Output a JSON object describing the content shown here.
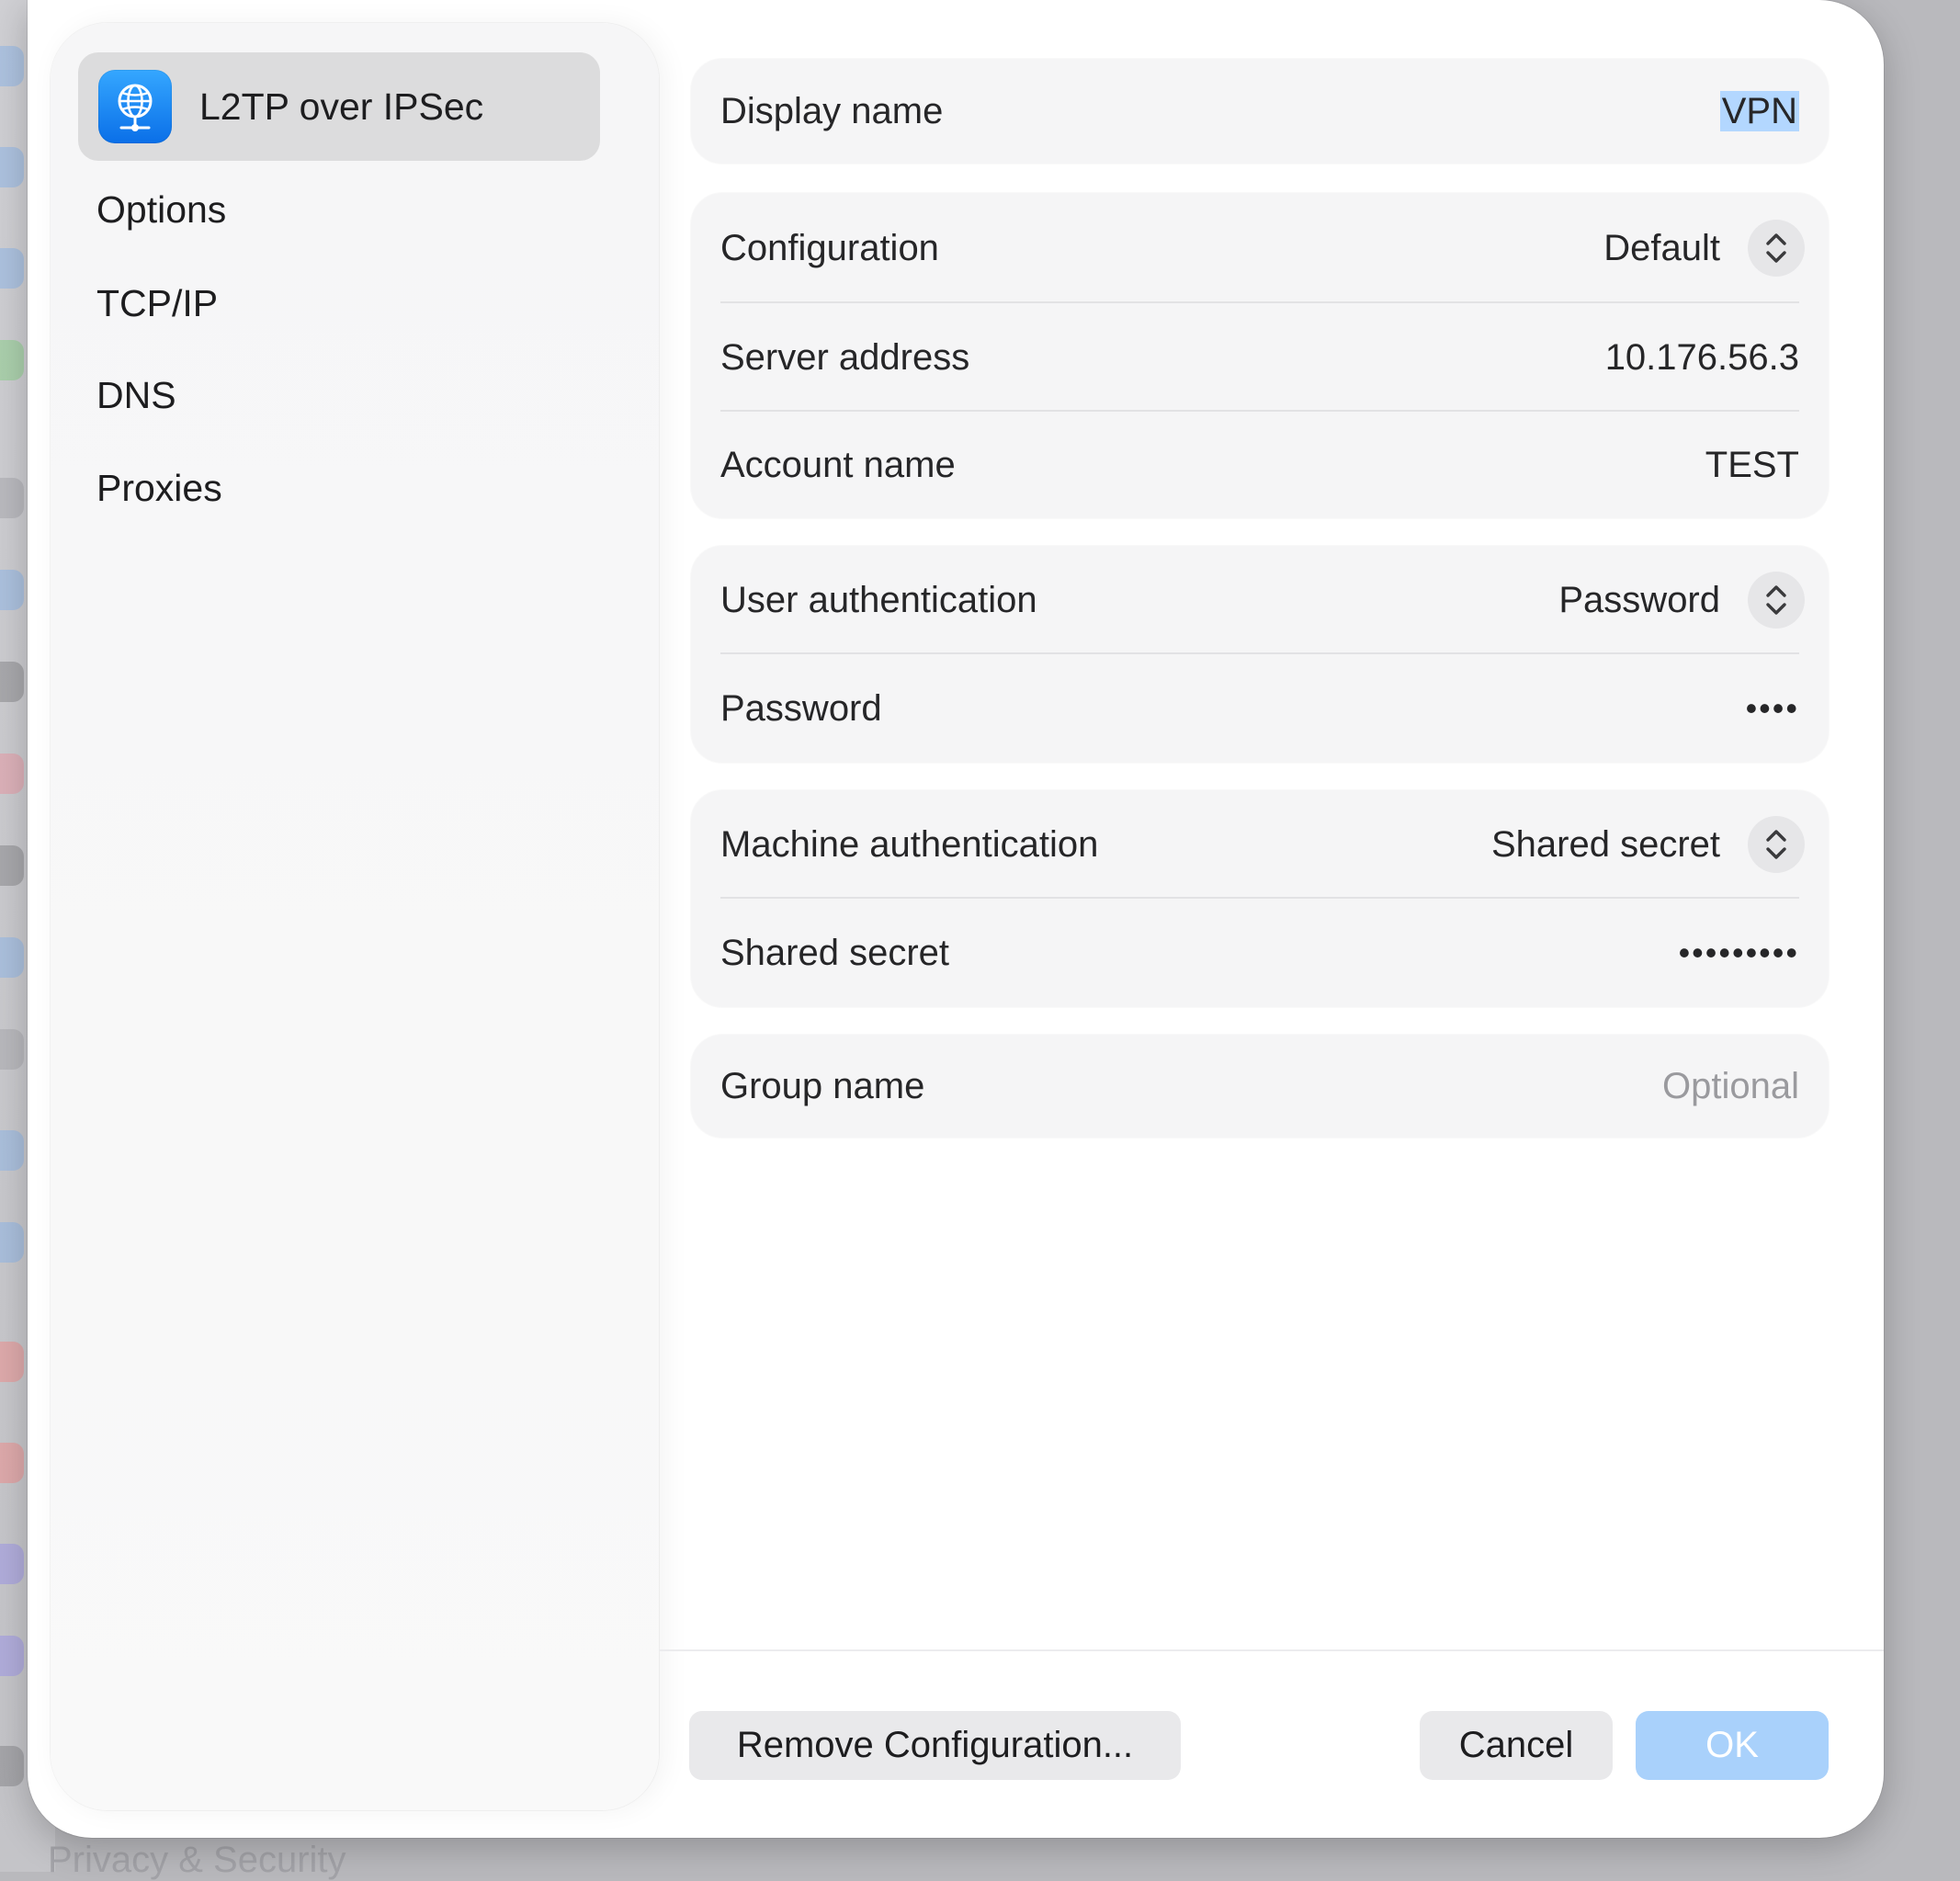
{
  "background": {
    "bottom_label": "Privacy & Security"
  },
  "sidebar": {
    "selected": {
      "label": "L2TP over IPSec",
      "icon": "globe-network-icon"
    },
    "items": [
      {
        "label": "Options"
      },
      {
        "label": "TCP/IP"
      },
      {
        "label": "DNS"
      },
      {
        "label": "Proxies"
      }
    ]
  },
  "display_name": {
    "label": "Display name",
    "value": "VPN"
  },
  "connection": {
    "configuration": {
      "label": "Configuration",
      "value": "Default"
    },
    "server_address": {
      "label": "Server address",
      "value": "10.176.56.3"
    },
    "account_name": {
      "label": "Account name",
      "value": "TEST"
    }
  },
  "user_auth": {
    "method": {
      "label": "User authentication",
      "value": "Password"
    },
    "password": {
      "label": "Password",
      "value": "••••"
    }
  },
  "machine_auth": {
    "method": {
      "label": "Machine authentication",
      "value": "Shared secret"
    },
    "secret": {
      "label": "Shared secret",
      "value": "•••••••••"
    }
  },
  "group": {
    "label": "Group name",
    "placeholder": "Optional"
  },
  "footer": {
    "remove_label": "Remove Configuration...",
    "cancel_label": "Cancel",
    "ok_label": "OK"
  },
  "colors": {
    "accent": "#0a6fe8",
    "ok_disabled": "#a9d1fb",
    "selection": "#b3d7ff"
  }
}
